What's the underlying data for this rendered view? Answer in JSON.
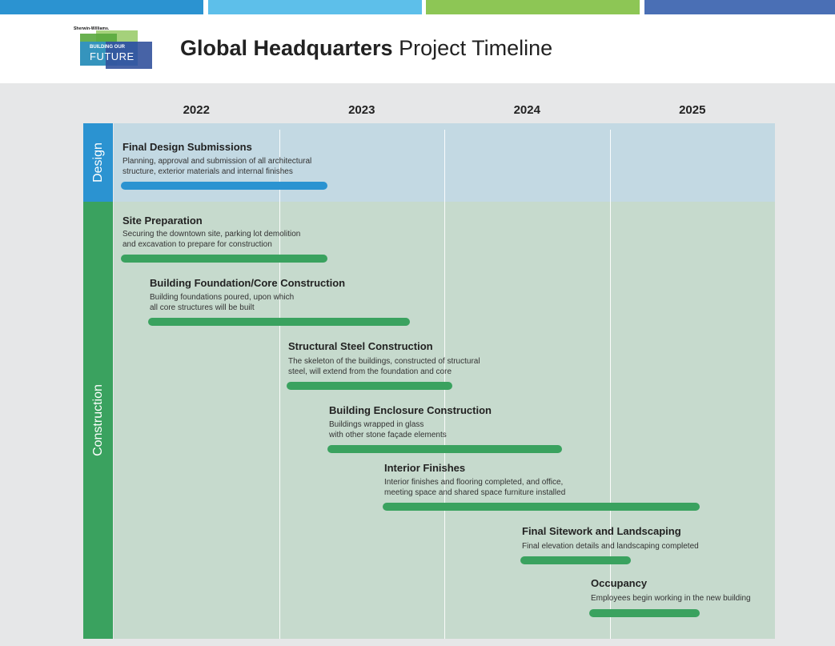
{
  "header": {
    "colors": [
      "#2b93d1",
      "#5dbfea",
      "#8dc655",
      "#4a6fb5"
    ],
    "logo": {
      "brand": "Sherwin-Williams.",
      "line1": "BUILDING OUR",
      "line2": "FUTURE"
    },
    "title_bold": "Global Headquarters",
    "title_light": "Project Timeline"
  },
  "chart_data": {
    "type": "gantt",
    "years": [
      "2022",
      "2023",
      "2024",
      "2025"
    ],
    "xlim": [
      "2022-01",
      "2025-12"
    ],
    "phases": [
      {
        "name": "Design",
        "color": "#2b93d1",
        "band_color": "#c3d9e3"
      },
      {
        "name": "Construction",
        "color": "#3aa25f",
        "band_color": "#c6dacd"
      }
    ],
    "tasks": [
      {
        "title": "Final Design Submissions",
        "description": "Planning, approval and submission of all architectural\nstructure, exterior materials and internal finishes",
        "phase": "Design",
        "start": "2022-01",
        "end": "2023-03"
      },
      {
        "title": "Site Preparation",
        "description": "Securing the downtown site, parking lot demolition\nand excavation to prepare for construction",
        "phase": "Construction",
        "start": "2022-01",
        "end": "2023-03"
      },
      {
        "title": "Building Foundation/Core Construction",
        "description": "Building foundations poured, upon which\nall core structures will be built",
        "phase": "Construction",
        "start": "2022-03",
        "end": "2023-09"
      },
      {
        "title": "Structural Steel Construction",
        "description": "The skeleton of the buildings, constructed of structural\nsteel, will extend from the foundation and core",
        "phase": "Construction",
        "start": "2023-01",
        "end": "2023-12"
      },
      {
        "title": "Building Enclosure Construction",
        "description": "Buildings wrapped in glass\nwith other stone façade elements",
        "phase": "Construction",
        "start": "2023-04",
        "end": "2024-08"
      },
      {
        "title": "Interior Finishes",
        "description": "Interior finishes and flooring completed, and office,\nmeeting space and shared space furniture installed",
        "phase": "Construction",
        "start": "2023-08",
        "end": "2025-06"
      },
      {
        "title": "Final Sitework and Landscaping",
        "description": "Final elevation details and landscaping completed",
        "phase": "Construction",
        "start": "2024-06",
        "end": "2025-01"
      },
      {
        "title": "Occupancy",
        "description": "Employees begin working in the new building",
        "phase": "Construction",
        "start": "2024-11",
        "end": "2025-06"
      }
    ]
  }
}
